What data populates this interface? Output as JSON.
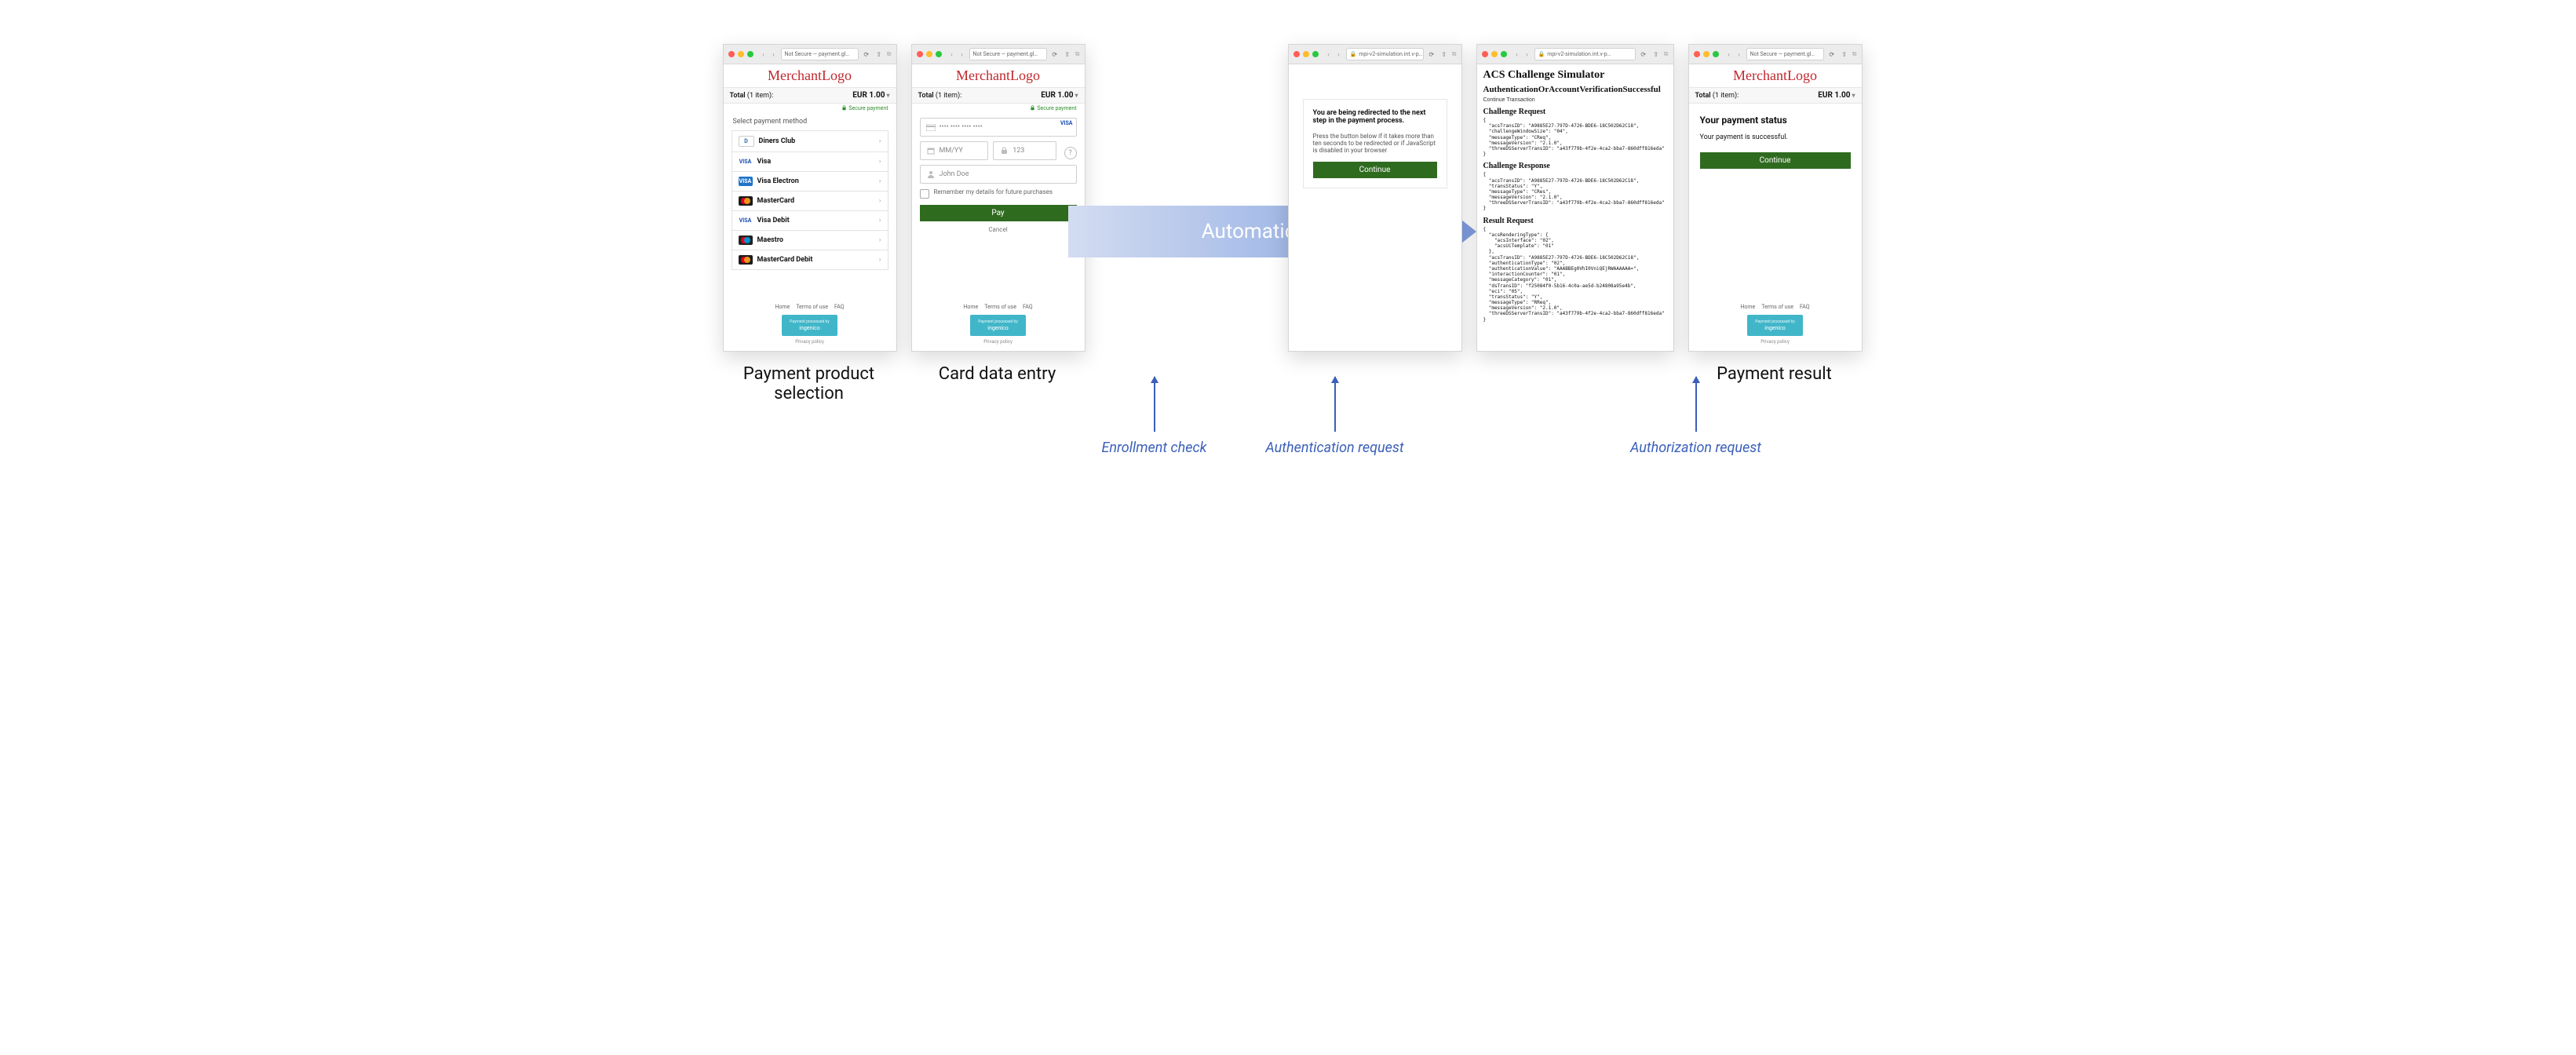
{
  "flow_arrow": "Automatic",
  "captions": {
    "step1": "Payment product selection",
    "step2": "Card data entry",
    "step5": "Payment result"
  },
  "callouts": {
    "enrollment": "Enrollment check",
    "auth_request": "Authentication request",
    "authz_request": "Authorization request"
  },
  "merchant": {
    "logo": "MerchantLogo",
    "addr": "Not Secure — payment.gl…",
    "total_label": "Total",
    "total_count": "(1 item):",
    "total_amount": "EUR 1.00",
    "secure": "Secure payment",
    "footer": {
      "home": "Home",
      "terms": "Terms of use",
      "faq": "FAQ",
      "privacy": "Privacy policy"
    },
    "badge": {
      "small": "Payment processed by",
      "name": "ingenico"
    }
  },
  "selection": {
    "header": "Select payment method",
    "items": [
      {
        "name": "Diners Club",
        "icon": "diners"
      },
      {
        "name": "Visa",
        "icon": "visa"
      },
      {
        "name": "Visa Electron",
        "icon": "vise"
      },
      {
        "name": "MasterCard",
        "icon": "mc"
      },
      {
        "name": "Visa Debit",
        "icon": "visa"
      },
      {
        "name": "Maestro",
        "icon": "maestro"
      },
      {
        "name": "MasterCard Debit",
        "icon": "mc"
      }
    ]
  },
  "cardform": {
    "pan_placeholder": "•••• •••• •••• ••••",
    "brand": "VISA",
    "exp_placeholder": "MM/YY",
    "cvv_placeholder": "123",
    "name_placeholder": "John Doe",
    "remember": "Remember my details for future purchases",
    "pay": "Pay",
    "cancel": "Cancel"
  },
  "redirect": {
    "addr": "mpi-v2-simulation.int.v-p…",
    "msg": "You are being redirected to the next step in the payment process.",
    "hint": "Press the button below if it takes more than ten seconds to be redirected or if JavaScript is disabled in your browser",
    "btn": "Continue"
  },
  "acs": {
    "addr": "mpi-v2-simulation.int.v-p…",
    "h1": "ACS Challenge Simulator",
    "h2": "AuthenticationOrAccountVerificationSuccessful",
    "continue": "Continue Transaction",
    "creq_h": "Challenge Request",
    "creq": "{\n  \"acsTransID\": \"A9885E27-797D-4726-BDE6-18C502D62C18\",\n  \"challengeWindowSize\": \"04\",\n  \"messageType\": \"CReq\",\n  \"messageVersion\": \"2.1.0\",\n  \"threeDSServerTransID\": \"a43f779b-4f2e-4ca2-bba7-860dff816eda\"\n}",
    "cres_h": "Challenge Response",
    "cres": "{\n  \"acsTransID\": \"A9885E27-797D-4726-BDE6-18C502D62C18\",\n  \"transStatus\": \"Y\",\n  \"messageType\": \"CRes\",\n  \"messageVersion\": \"2.1.0\",\n  \"threeDSServerTransID\": \"a43f779b-4f2e-4ca2-bba7-860dff816eda\"\n}",
    "rreq_h": "Result Request",
    "rreq": "{\n  \"acsRenderingType\": {\n    \"acsInterface\": \"02\",\n    \"acsUiTemplate\": \"01\"\n  },\n  \"acsTransID\": \"A9885E27-797D-4726-BDE6-18C502D62C18\",\n  \"authenticationType\": \"02\",\n  \"authenticationValue\": \"AAABBEg0VhI0VniQEjRWAAAAAA=\",\n  \"interactionCounter\": \"01\",\n  \"messageCategory\": \"01\",\n  \"dsTransID\": \"f25084f0-5b16-4c0a-ae5d-b24808a95e4b\",\n  \"eci\": \"05\",\n  \"transStatus\": \"Y\",\n  \"messageType\": \"RReq\",\n  \"messageVersion\": \"2.1.0\",\n  \"threeDSServerTransID\": \"a43f779b-4f2e-4ca2-bba7-860dff816eda\"\n}"
  },
  "result": {
    "heading": "Your payment status",
    "msg": "Your payment is successful.",
    "btn": "Continue"
  }
}
